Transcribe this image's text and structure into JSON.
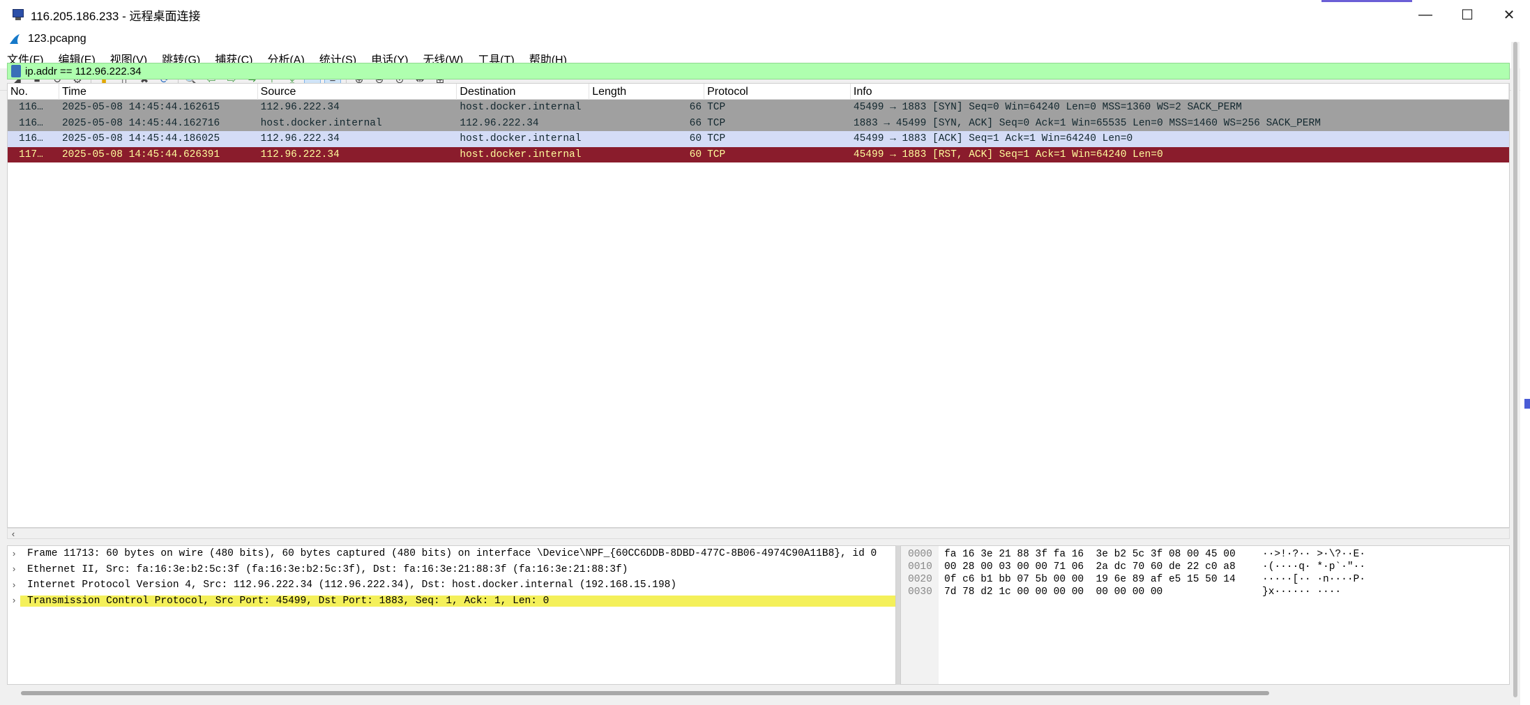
{
  "remote_window": {
    "title": "116.205.186.233 - 远程桌面连接",
    "min_glyph": "—",
    "max_glyph": "☐",
    "close_glyph": "✕",
    "icon": "remote-desktop-icon"
  },
  "wireshark": {
    "title": "123.pcapng",
    "icon": "wireshark-fin-icon"
  },
  "menu": [
    "文件(F)",
    "编辑(E)",
    "视图(V)",
    "跳转(G)",
    "捕获(C)",
    "分析(A)",
    "统计(S)",
    "电话(Y)",
    "无线(W)",
    "工具(T)",
    "帮助(H)"
  ],
  "toolbar": {
    "glyphs": {
      "start": "◢",
      "stop": "■",
      "restart": "↻",
      "options": "⚙",
      "open": "▮",
      "save": "▯",
      "close": "✖",
      "reload": "⟳",
      "find": "🔍",
      "back": "⇦",
      "forward": "⇨",
      "goto": "↪",
      "first": "⤒",
      "last": "⤓",
      "autoscroll": "▁",
      "colorize": "≡",
      "zoom_in": "⊕",
      "zoom_out": "⊖",
      "zoom_reset": "⊙",
      "resize_columns": "⇹",
      "layout": "⊞"
    }
  },
  "filter": {
    "value": "ip.addr == 112.96.222.34"
  },
  "packet_list": {
    "columns": [
      "No.",
      "Time",
      "Source",
      "Destination",
      "Length",
      "Protocol",
      "Info"
    ],
    "rows": [
      {
        "no": "116…",
        "time": "2025-05-08 14:45:44.162615",
        "source": "112.96.222.34",
        "destination": "host.docker.internal",
        "length": "66",
        "protocol": "TCP",
        "info": "45499 → 1883 [SYN] Seq=0 Win=64240 Len=0 MSS=1360 WS=2 SACK_PERM",
        "style": "gray"
      },
      {
        "no": "116…",
        "time": "2025-05-08 14:45:44.162716",
        "source": "host.docker.internal",
        "destination": "112.96.222.34",
        "length": "66",
        "protocol": "TCP",
        "info": "1883 → 45499 [SYN, ACK] Seq=0 Ack=1 Win=65535 Len=0 MSS=1460 WS=256 SACK_PERM",
        "style": "gray"
      },
      {
        "no": "116…",
        "time": "2025-05-08 14:45:44.186025",
        "source": "112.96.222.34",
        "destination": "host.docker.internal",
        "length": "60",
        "protocol": "TCP",
        "info": "45499 → 1883 [ACK] Seq=1 Ack=1 Win=64240 Len=0",
        "style": "selected"
      },
      {
        "no": "117…",
        "time": "2025-05-08 14:45:44.626391",
        "source": "112.96.222.34",
        "destination": "host.docker.internal",
        "length": "60",
        "protocol": "TCP",
        "info": "45499 → 1883 [RST, ACK] Seq=1 Ack=1 Win=64240 Len=0",
        "style": "rst"
      }
    ]
  },
  "details": {
    "rows": [
      {
        "text": "Frame 11713: 60 bytes on wire (480 bits), 60 bytes captured (480 bits) on interface \\Device\\NPF_{60CC6DDB-8DBD-477C-8B06-4974C90A11B8}, id 0",
        "highlight": false
      },
      {
        "text": "Ethernet II, Src: fa:16:3e:b2:5c:3f (fa:16:3e:b2:5c:3f), Dst: fa:16:3e:21:88:3f (fa:16:3e:21:88:3f)",
        "highlight": false
      },
      {
        "text": "Internet Protocol Version 4, Src: 112.96.222.34 (112.96.222.34), Dst: host.docker.internal (192.168.15.198)",
        "highlight": false
      },
      {
        "text": "Transmission Control Protocol, Src Port: 45499, Dst Port: 1883, Seq: 1, Ack: 1, Len: 0",
        "highlight": true
      }
    ],
    "chevron": "›"
  },
  "bytes": {
    "rows": [
      {
        "offset": "0000",
        "hex": "fa 16 3e 21 88 3f fa 16  3e b2 5c 3f 08 00 45 00",
        "ascii": "··>!·?·· >·\\?··E·"
      },
      {
        "offset": "0010",
        "hex": "00 28 00 03 00 00 71 06  2a dc 70 60 de 22 c0 a8",
        "ascii": "·(····q· *·p`·\"··"
      },
      {
        "offset": "0020",
        "hex": "0f c6 b1 bb 07 5b 00 00  19 6e 89 af e5 15 50 14",
        "ascii": "·····[·· ·n····P·"
      },
      {
        "offset": "0030",
        "hex": "7d 78 d2 1c 00 00 00 00  00 00 00 00",
        "ascii": "}x······ ····"
      }
    ]
  },
  "scroll": {
    "left_arrow": "‹"
  }
}
